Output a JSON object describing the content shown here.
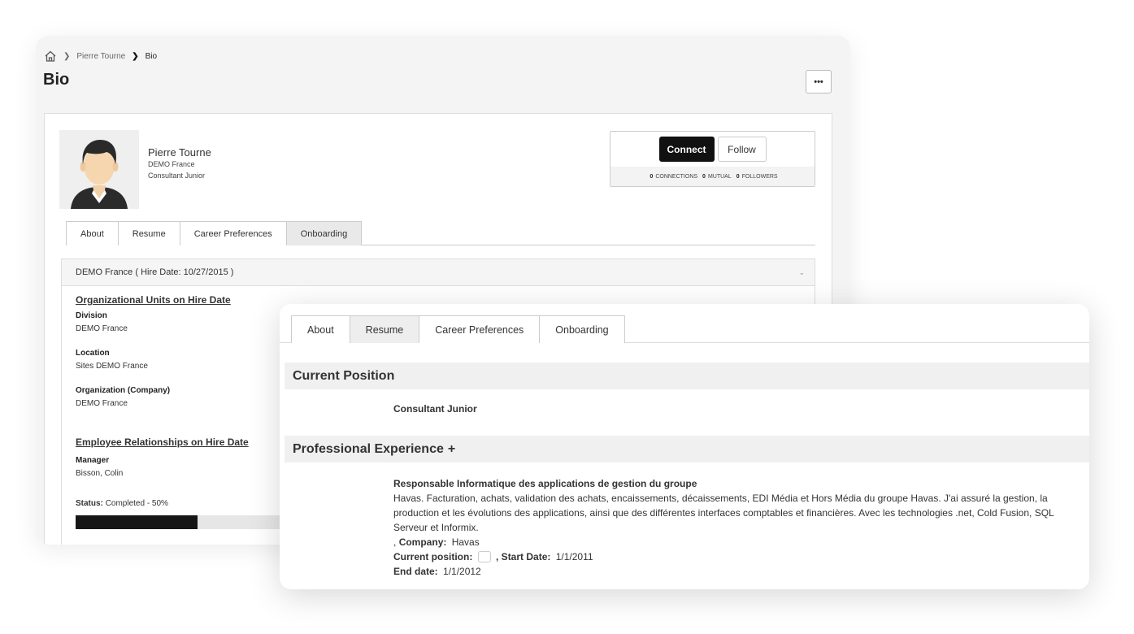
{
  "breadcrumb": {
    "items": [
      "Pierre Tourne",
      "Bio"
    ]
  },
  "page": {
    "title": "Bio",
    "more_label": "•••"
  },
  "profile": {
    "name": "Pierre Tourne",
    "company": "DEMO France",
    "position": "Consultant Junior"
  },
  "social": {
    "connect_label": "Connect",
    "follow_label": "Follow",
    "connections_count": "0",
    "connections_label": "CONNECTIONS",
    "mutual_count": "0",
    "mutual_label": "MUTUAL",
    "followers_count": "0",
    "followers_label": "FOLLOWERS"
  },
  "tabs": [
    {
      "label": "About"
    },
    {
      "label": "Resume"
    },
    {
      "label": "Career Preferences"
    },
    {
      "label": "Onboarding"
    }
  ],
  "back_active_tab": "Onboarding",
  "front_active_tab": "Resume",
  "onboarding": {
    "header": "DEMO France ( Hire Date: 10/27/2015 )",
    "org_units_title": "Organizational Units on Hire Date",
    "division_label": "Division",
    "division_value": "DEMO France",
    "location_label": "Location",
    "location_value": "Sites DEMO France",
    "organization_label": "Organization (Company)",
    "organization_value": "DEMO France",
    "relationships_title": "Employee Relationships on Hire Date",
    "manager_label": "Manager",
    "manager_value": "Bisson, Colin",
    "status_label": "Status:",
    "status_value": "Completed - 50%",
    "progress_fraction": 0.5
  },
  "resume": {
    "current_position_heading": "Current Position",
    "current_position": "Consultant Junior",
    "experience_heading": "Professional Experience",
    "experience_add": "+",
    "experience": {
      "title": "Responsable Informatique des applications de gestion du groupe",
      "description": "Havas. Facturation, achats, validation des achats, encaissements, décaissements, EDI Média et Hors Média du groupe Havas. J'ai assuré la gestion, la production et les évolutions des applications, ainsi que des différentes interfaces comptables et financières. Avec les technologies .net, Cold Fusion, SQL Serveur et Informix.",
      "company_prefix": ",",
      "company_label": "Company:",
      "company_value": "Havas",
      "current_label": "Current position:",
      "start_label": ", Start Date:",
      "start_value": "1/1/2011",
      "end_label": "End date:",
      "end_value": "1/1/2012"
    }
  },
  "icons": {
    "home": "home-icon",
    "chevron": "chevron-right-icon",
    "collapse": "chevron-down-icon"
  },
  "colors": {
    "primary_button": "#111111",
    "progress_fill": "#161616"
  }
}
